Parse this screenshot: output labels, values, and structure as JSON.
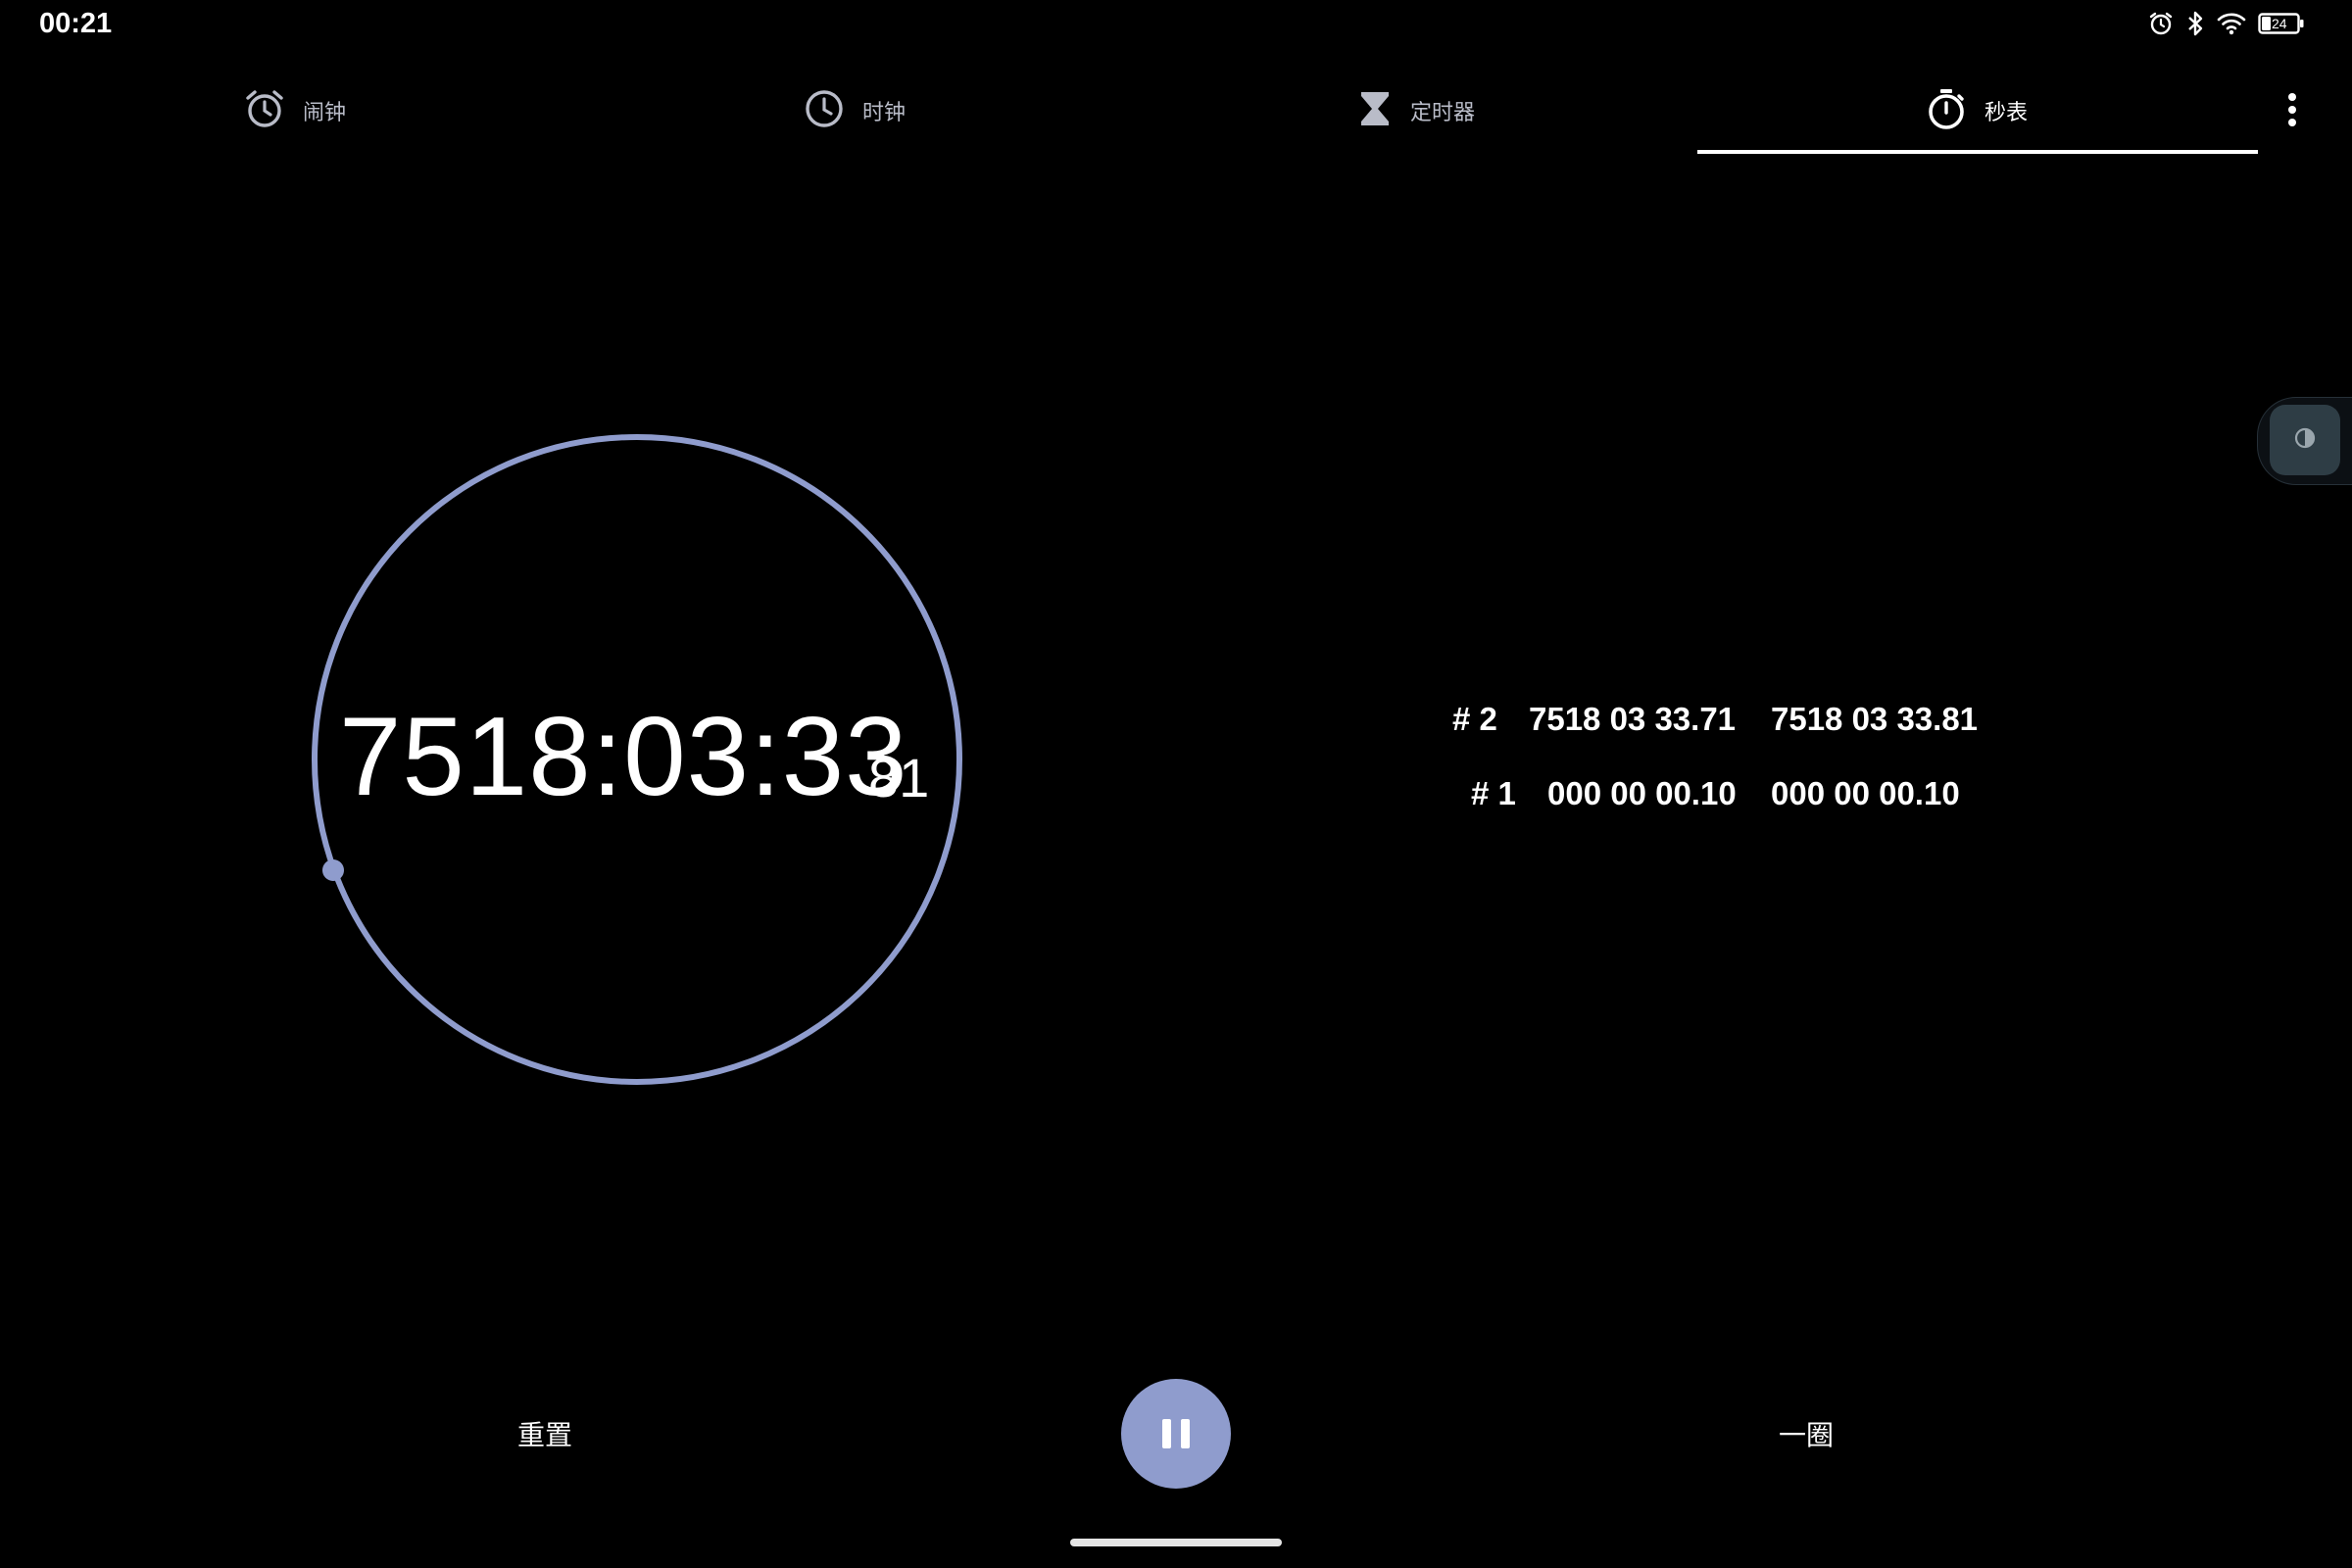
{
  "status_bar": {
    "time": "00:21",
    "battery_level": "24"
  },
  "tabs": [
    {
      "label": "闹钟",
      "icon": "alarm-icon",
      "active": false
    },
    {
      "label": "时钟",
      "icon": "clock-icon",
      "active": false
    },
    {
      "label": "定时器",
      "icon": "hourglass-icon",
      "active": false
    },
    {
      "label": "秒表",
      "icon": "stopwatch-icon",
      "active": true
    }
  ],
  "stopwatch": {
    "elapsed": "7518:03:33",
    "hundredths": "81"
  },
  "laps": [
    {
      "number": "# 2",
      "lap_time": "7518 03 33.71",
      "total_time": "7518 03 33.81"
    },
    {
      "number": "# 1",
      "lap_time": "000 00 00.10",
      "total_time": "000 00 00.10"
    }
  ],
  "controls": {
    "reset_label": "重置",
    "lap_label": "一圈",
    "pause_icon": "pause-icon"
  },
  "colors": {
    "accent": "#8f9ccd",
    "background": "#000000"
  }
}
